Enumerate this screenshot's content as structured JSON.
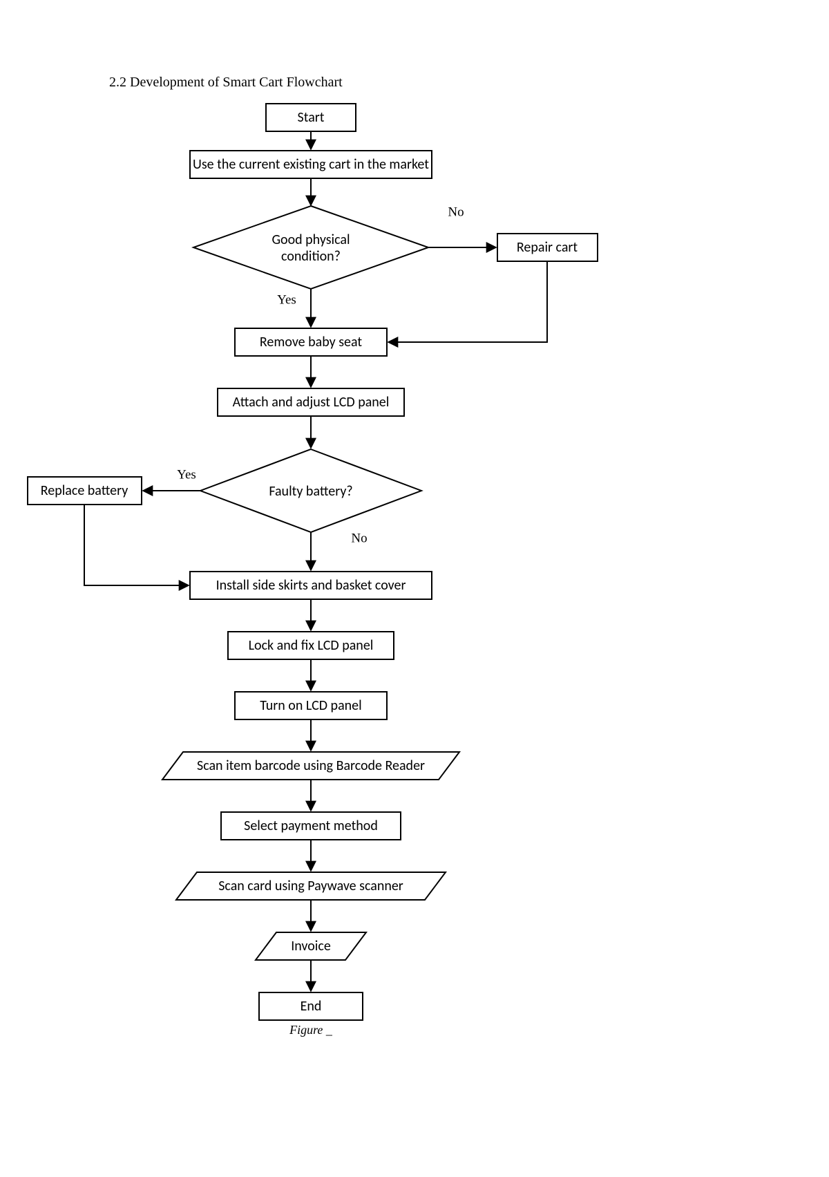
{
  "section_title": "2.2 Development of Smart Cart Flowchart",
  "nodes": {
    "start": "Start",
    "use_cart": "Use the current existing cart in the market",
    "good_cond_1": "Good physical",
    "good_cond_2": "condition?",
    "repair": "Repair cart",
    "remove_seat": "Remove baby seat",
    "attach_lcd": "Attach and adjust LCD panel",
    "faulty_batt": "Faulty battery?",
    "replace_batt": "Replace battery",
    "install_skirts": "Install side skirts and basket cover",
    "lock_lcd": "Lock and fix LCD panel",
    "turn_on": "Turn on LCD panel",
    "scan_barcode": "Scan item barcode using Barcode Reader",
    "select_payment": "Select payment method",
    "scan_card": "Scan card using Paywave scanner",
    "invoice": "Invoice",
    "end": "End"
  },
  "labels": {
    "yes": "Yes",
    "no": "No"
  },
  "caption": "Figure _"
}
